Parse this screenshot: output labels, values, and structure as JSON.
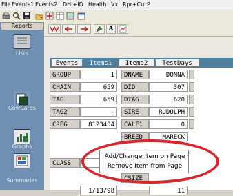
{
  "menubar": [
    "File",
    "Events1",
    "Events2",
    "DHI+ID",
    "Health",
    "Vx",
    "Rpr+Cul",
    "P"
  ],
  "sidebar": {
    "header": "Reports",
    "items": [
      "Lists",
      "CowCards",
      "Graphs",
      "Summaries"
    ]
  },
  "tabs": [
    "Events",
    "Items1",
    "Items2",
    "TestDays"
  ],
  "fields": {
    "left": [
      {
        "label": "GROUP",
        "value": "1"
      },
      {
        "label": "CHAIN",
        "value": "659"
      },
      {
        "label": "TAG",
        "value": "659"
      },
      {
        "label": "TAG2",
        "value": "-"
      },
      {
        "label": "CREG",
        "value": "8123404"
      },
      {
        "label": "CLASS",
        "value": ""
      }
    ],
    "right": [
      {
        "label": "DNAME",
        "value": "DONNA"
      },
      {
        "label": "DID",
        "value": "307"
      },
      {
        "label": "DTAG",
        "value": "620"
      },
      {
        "label": "SIRE",
        "value": "RUDOLPH"
      },
      {
        "label": "CALF1",
        "value": "0"
      },
      {
        "label": "BREED",
        "value": "MARECK"
      },
      {
        "label": "",
        "value": ""
      },
      {
        "label": "CSIZE",
        "value": ""
      }
    ],
    "bottom_left_value": "1/13/98",
    "bottom_right_value": "11"
  },
  "context_menu": {
    "items": [
      "Add/Change Item on Page",
      "Remove Item from Page"
    ]
  },
  "colors": {
    "highlight_oval": "#d8262b",
    "tab_strip": "#4d7fa0",
    "sidebar": "#6f8fb2",
    "selected_tab": "#4d7fa0"
  }
}
